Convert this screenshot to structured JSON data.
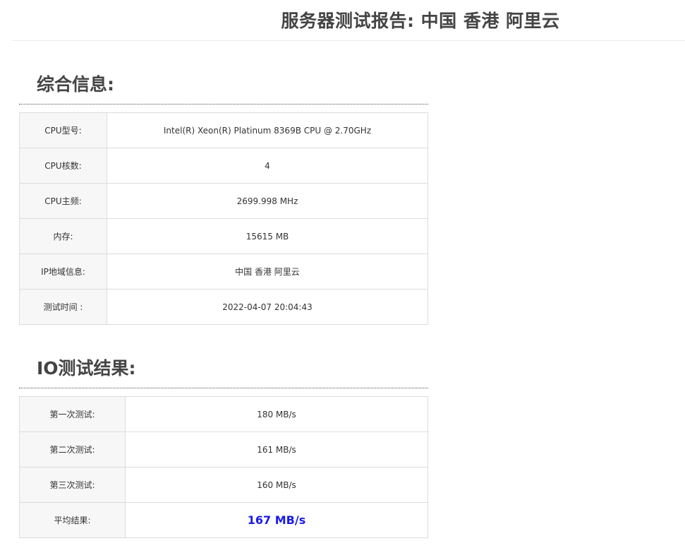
{
  "report": {
    "title": "服务器测试报告: 中国 香港 阿里云"
  },
  "general": {
    "heading": "综合信息:",
    "rows": [
      {
        "label": "CPU型号:",
        "value": "Intel(R) Xeon(R) Platinum 8369B CPU @ 2.70GHz"
      },
      {
        "label": "CPU核数:",
        "value": "4"
      },
      {
        "label": "CPU主频:",
        "value": "2699.998 MHz"
      },
      {
        "label": "内存:",
        "value": "15615 MB"
      },
      {
        "label": "IP地域信息:",
        "value": "中国 香港 阿里云"
      },
      {
        "label": "测试时间 :",
        "value": "2022-04-07 20:04:43"
      }
    ]
  },
  "io": {
    "heading": "IO测试结果:",
    "rows": [
      {
        "label": "第一次测试:",
        "value": "180 MB/s"
      },
      {
        "label": "第二次测试:",
        "value": "161 MB/s"
      },
      {
        "label": "第三次测试:",
        "value": "160 MB/s"
      },
      {
        "label": "平均结果:",
        "value": "167 MB/s"
      }
    ],
    "highlight_color": "#1a1ae6"
  }
}
